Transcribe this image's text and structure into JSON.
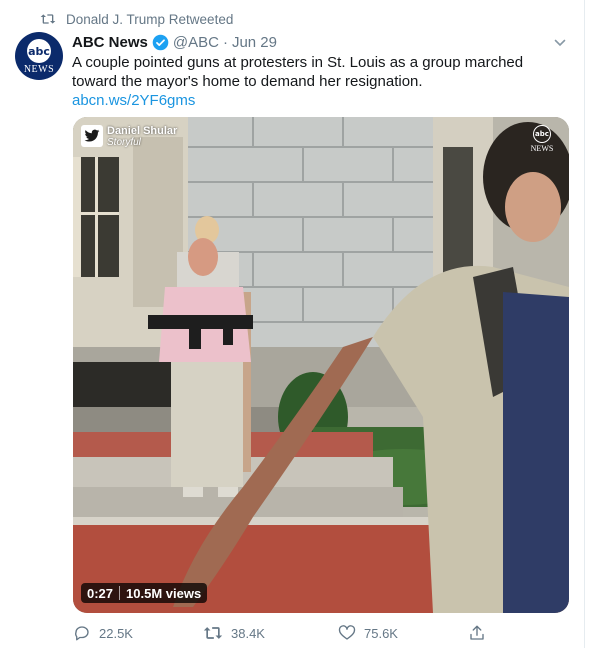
{
  "retweet": {
    "text": "Donald J. Trump Retweeted",
    "icon": "retweet-icon"
  },
  "author": {
    "name": "ABC News",
    "handle": "@ABC",
    "separator": "·",
    "date": "Jun 29",
    "avatar_text_top": "abc",
    "avatar_text_bottom": "NEWS",
    "verified": true
  },
  "tweet": {
    "text": "A couple pointed guns at protesters in St. Louis as a group marched toward the mayor's home to demand her resignation.",
    "link": "abcn.ws/2YF6gms"
  },
  "media": {
    "credit_name": "Daniel Shular",
    "credit_source": "Storyful",
    "bug_top": "abc",
    "bug_bottom": "NEWS",
    "duration": "0:27",
    "views": "10.5M views"
  },
  "actions": {
    "replies": "22.5K",
    "retweets": "38.4K",
    "likes": "75.6K"
  },
  "colors": {
    "link": "#1b95e0",
    "muted": "#657786",
    "text": "#14171a",
    "avatar_bg": "#0b2a6b"
  }
}
